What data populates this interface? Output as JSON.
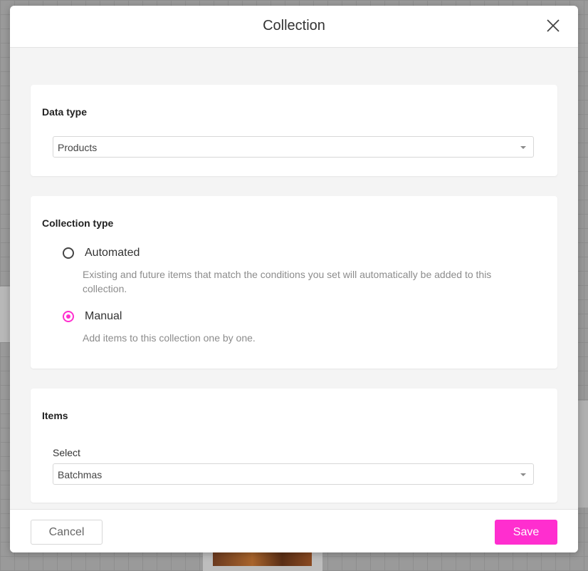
{
  "dialog": {
    "title": "Collection",
    "close_icon": "close-icon"
  },
  "data_type": {
    "title": "Data type",
    "selected": "Products"
  },
  "collection_type": {
    "title": "Collection type",
    "options": [
      {
        "label": "Automated",
        "description": "Existing and future items that match the conditions you set will automatically be added to this collection.",
        "checked": false
      },
      {
        "label": "Manual",
        "description": "Add items to this collection one by one.",
        "checked": true
      }
    ]
  },
  "items": {
    "title": "Items",
    "select_label": "Select",
    "selected": "Batchmas"
  },
  "footer": {
    "cancel_label": "Cancel",
    "save_label": "Save"
  },
  "colors": {
    "accent": "#ff2ecf"
  }
}
